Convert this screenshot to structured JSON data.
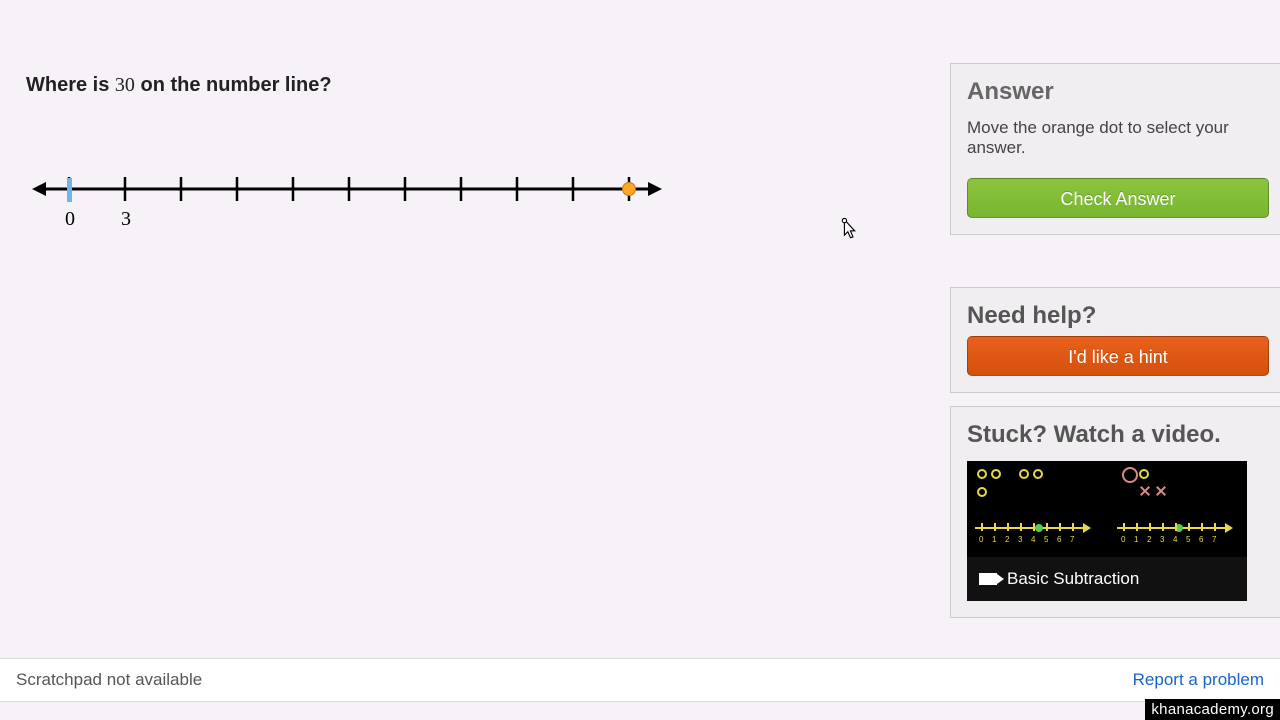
{
  "question": {
    "prefix": "Where is ",
    "number": "30",
    "suffix": " on the number line?"
  },
  "numberline": {
    "labels": {
      "zero": "0",
      "first": "3"
    },
    "tick_count": 10,
    "dot_tick_index": 10,
    "tick_values": [
      0,
      3,
      6,
      9,
      12,
      15,
      18,
      21,
      24,
      27,
      30
    ]
  },
  "panels": {
    "answer": {
      "title": "Answer",
      "instruction": "Move the orange dot to select your answer.",
      "button": "Check Answer"
    },
    "help": {
      "title": "Need help?",
      "button": "I'd like a hint"
    },
    "video": {
      "title": "Stuck? Watch a video.",
      "video_title": "Basic Subtraction"
    }
  },
  "footer": {
    "scratchpad": "Scratchpad not available",
    "report": "Report a problem"
  },
  "watermark": "khanacademy.org",
  "chart_data": {
    "type": "numberline",
    "range": [
      0,
      30
    ],
    "tick_interval": 3,
    "labeled_ticks": {
      "0": 0,
      "3": 3
    },
    "marker_value": 30,
    "start_mark_value": 0
  }
}
